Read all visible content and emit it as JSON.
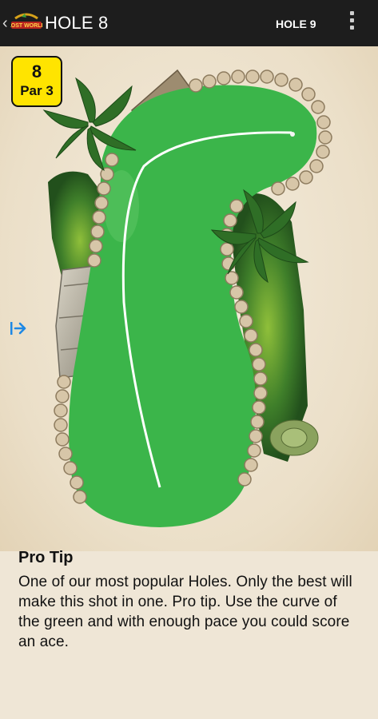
{
  "appbar": {
    "back_icon": "chevron-left-icon",
    "logo_text": "LOST WORLD",
    "title": "HOLE 8",
    "next_label": "HOLE 9",
    "menu_icon": "more-vertical-icon"
  },
  "hole": {
    "number": "8",
    "par_label": "Par 3"
  },
  "side_icon": "collapse-arrow-icon",
  "pro_tip": {
    "title": "Pro Tip",
    "body": "One of our most popular Holes. Only the best will make this shot in one. Pro tip. Use the curve of the green and with enough pace you could score an ace."
  },
  "colors": {
    "appbar": "#1d1d1d",
    "badge": "#ffe400",
    "green": "#3bb54a",
    "accent_blue": "#1e88e5"
  }
}
